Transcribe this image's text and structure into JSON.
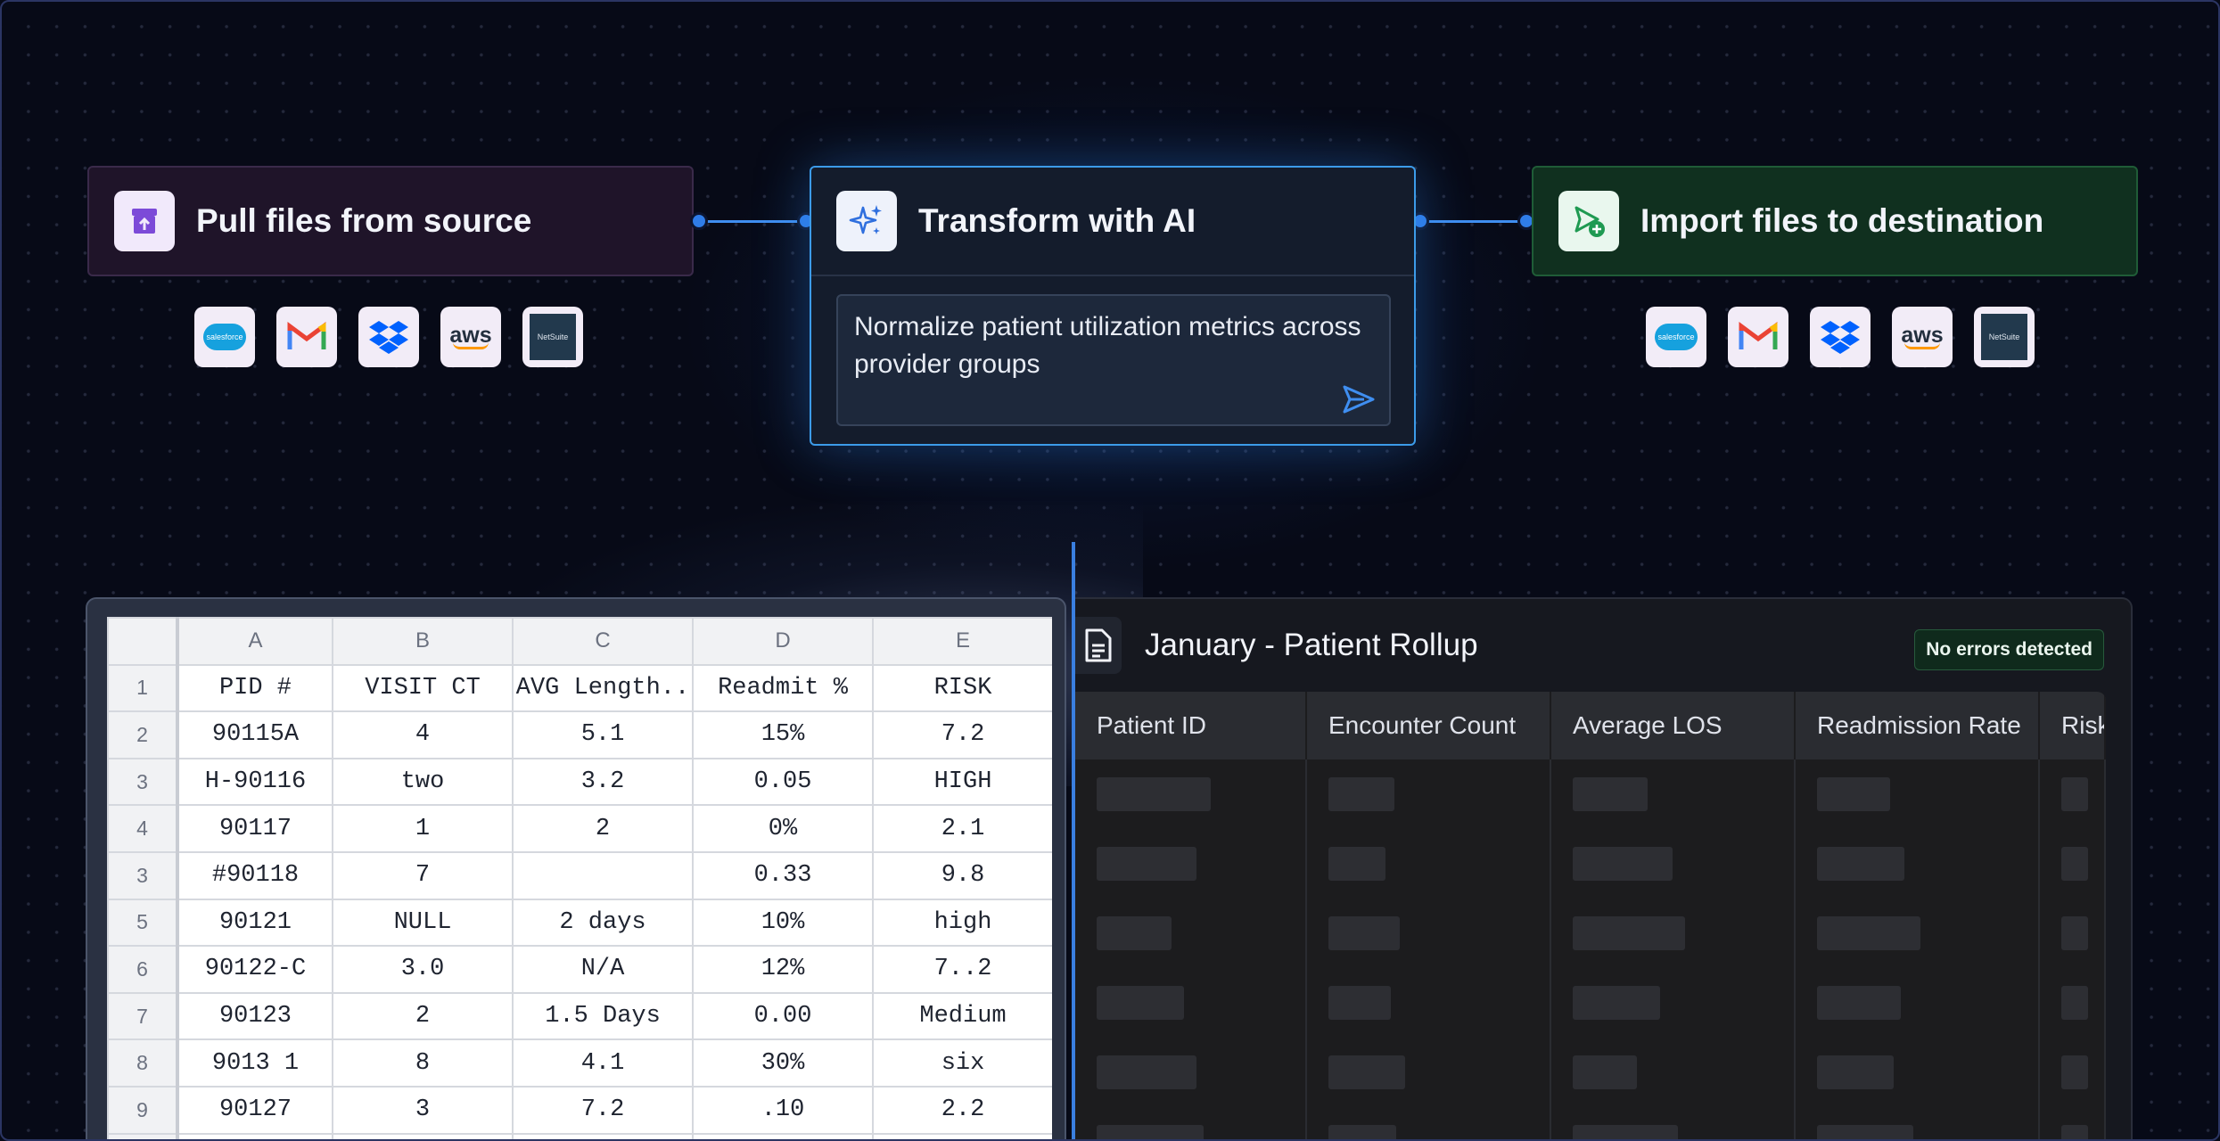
{
  "workflow": {
    "source": {
      "title": "Pull files from source",
      "icon": "upload-archive-icon"
    },
    "transform": {
      "title": "Transform with AI",
      "icon": "sparkles-icon",
      "prompt": "Normalize patient utilization metrics across provider groups"
    },
    "destination": {
      "title": "Import files to destination",
      "icon": "send-file-icon"
    },
    "integrations": [
      "salesforce",
      "gmail",
      "dropbox",
      "aws",
      "netsuite"
    ],
    "integration_text": {
      "salesforce": "salesforce",
      "aws": "aws",
      "netsuite": "NetSuite"
    },
    "accent_color": "#3f8ef0"
  },
  "spreadsheet": {
    "columns": [
      "A",
      "B",
      "C",
      "D",
      "E"
    ],
    "rows": [
      {
        "n": "1",
        "cells": [
          "PID #",
          "VISIT CT",
          "AVG Length..",
          "Readmit %",
          "RISK"
        ]
      },
      {
        "n": "2",
        "cells": [
          "90115A",
          "4",
          "5.1",
          "15%",
          "7.2"
        ]
      },
      {
        "n": "3",
        "cells": [
          "H-90116",
          "two",
          "3.2",
          "0.05",
          "HIGH"
        ]
      },
      {
        "n": "4",
        "cells": [
          "90117",
          "1",
          "2",
          "0%",
          "2.1"
        ]
      },
      {
        "n": "3",
        "cells": [
          "#90118",
          "7",
          "",
          "0.33",
          "9.8"
        ]
      },
      {
        "n": "5",
        "cells": [
          "90121",
          "NULL",
          "2 days",
          "10%",
          "high"
        ]
      },
      {
        "n": "6",
        "cells": [
          "90122-C",
          "3.0",
          "N/A",
          "12%",
          "7..2"
        ]
      },
      {
        "n": "7",
        "cells": [
          "90123",
          "2",
          "1.5 Days",
          "0.00",
          "Medium"
        ]
      },
      {
        "n": "8",
        "cells": [
          "9013 1",
          "8",
          "4.1",
          "30%",
          "six"
        ]
      },
      {
        "n": "9",
        "cells": [
          "90127",
          "3",
          "7.2",
          ".10",
          "2.2"
        ]
      },
      {
        "n": "",
        "cells": [
          "",
          "",
          "",
          "",
          ""
        ]
      }
    ]
  },
  "rollup": {
    "title": "January - Patient Rollup",
    "status": "No errors detected",
    "headers": [
      "Patient ID",
      "Encounter Count",
      "Average LOS",
      "Readmission Rate",
      "Risk"
    ]
  }
}
